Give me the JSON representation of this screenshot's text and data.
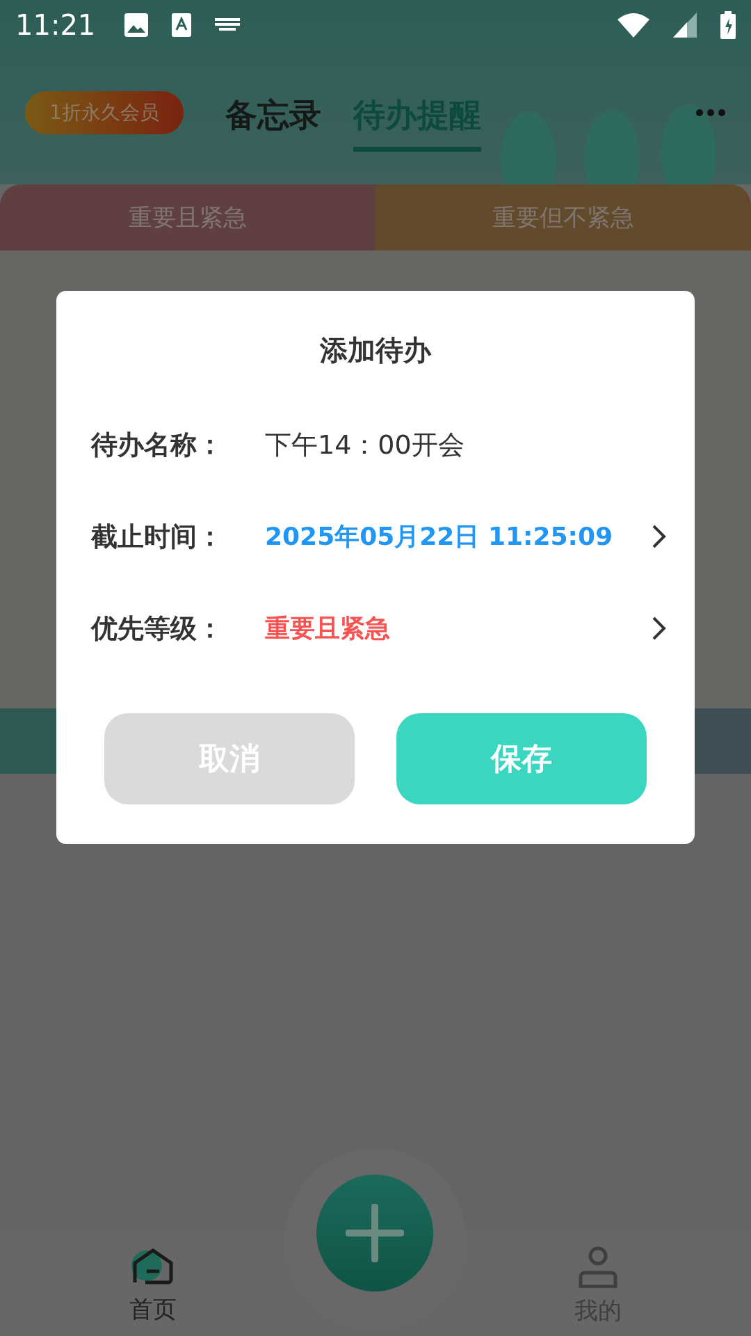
{
  "status_bar": {
    "time": "11:21"
  },
  "header": {
    "vip_badge": "1折永久会员",
    "tabs": [
      {
        "label": "备忘录",
        "selected": false
      },
      {
        "label": "待办提醒",
        "selected": true
      }
    ]
  },
  "quadrant_tabs": [
    {
      "label": "重要且紧急",
      "color": "#5f3f3f"
    },
    {
      "label": "重要但不紧急",
      "color": "#624a2d"
    }
  ],
  "dialog": {
    "title": "添加待办",
    "fields": [
      {
        "kind": "input",
        "label": "待办名称：",
        "value": "下午14：00开会"
      },
      {
        "kind": "picker",
        "label": "截止时间：",
        "value": "2025年05月22日 11:25:09",
        "color": "#2196f3"
      },
      {
        "kind": "picker",
        "label": "优先等级：",
        "value": "重要且紧急",
        "color": "#fa5151"
      }
    ],
    "buttons": [
      {
        "kind": "cancel",
        "label": "取消"
      },
      {
        "kind": "save",
        "label": "保存"
      }
    ]
  },
  "bottom_nav": {
    "items": [
      {
        "label": "首页",
        "selected": true
      },
      {
        "label": "我的",
        "selected": false
      }
    ]
  }
}
